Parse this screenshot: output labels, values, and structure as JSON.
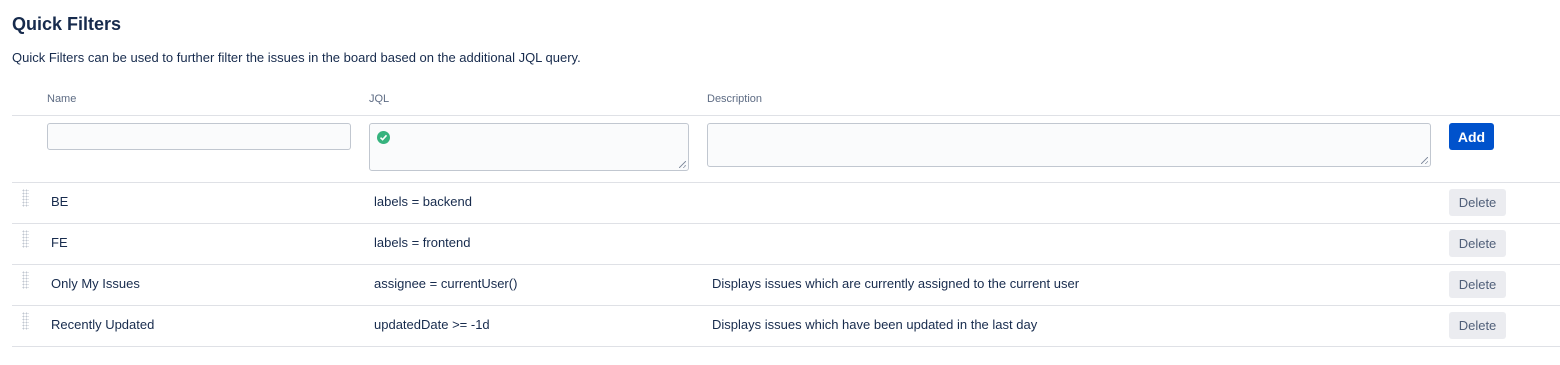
{
  "page": {
    "title": "Quick Filters",
    "description": "Quick Filters can be used to further filter the issues in the board based on the additional JQL query."
  },
  "table": {
    "headers": {
      "name": "Name",
      "jql": "JQL",
      "description": "Description"
    },
    "new_filter": {
      "name_value": "",
      "jql_value": "",
      "description_value": "",
      "jql_status_icon": "check-circle-icon",
      "add_label": "Add"
    },
    "rows": [
      {
        "name": "BE",
        "jql": "labels = backend",
        "description": "",
        "delete_label": "Delete"
      },
      {
        "name": "FE",
        "jql": "labels = frontend",
        "description": "",
        "delete_label": "Delete"
      },
      {
        "name": "Only My Issues",
        "jql": "assignee = currentUser()",
        "description": "Displays issues which are currently assigned to the current user",
        "delete_label": "Delete"
      },
      {
        "name": "Recently Updated",
        "jql": "updatedDate >= -1d",
        "description": "Displays issues which have been updated in the last day",
        "delete_label": "Delete"
      }
    ]
  },
  "colors": {
    "primary": "#0052cc",
    "success": "#36b37e",
    "text": "#172b4d",
    "subtle": "#5e6c84"
  }
}
